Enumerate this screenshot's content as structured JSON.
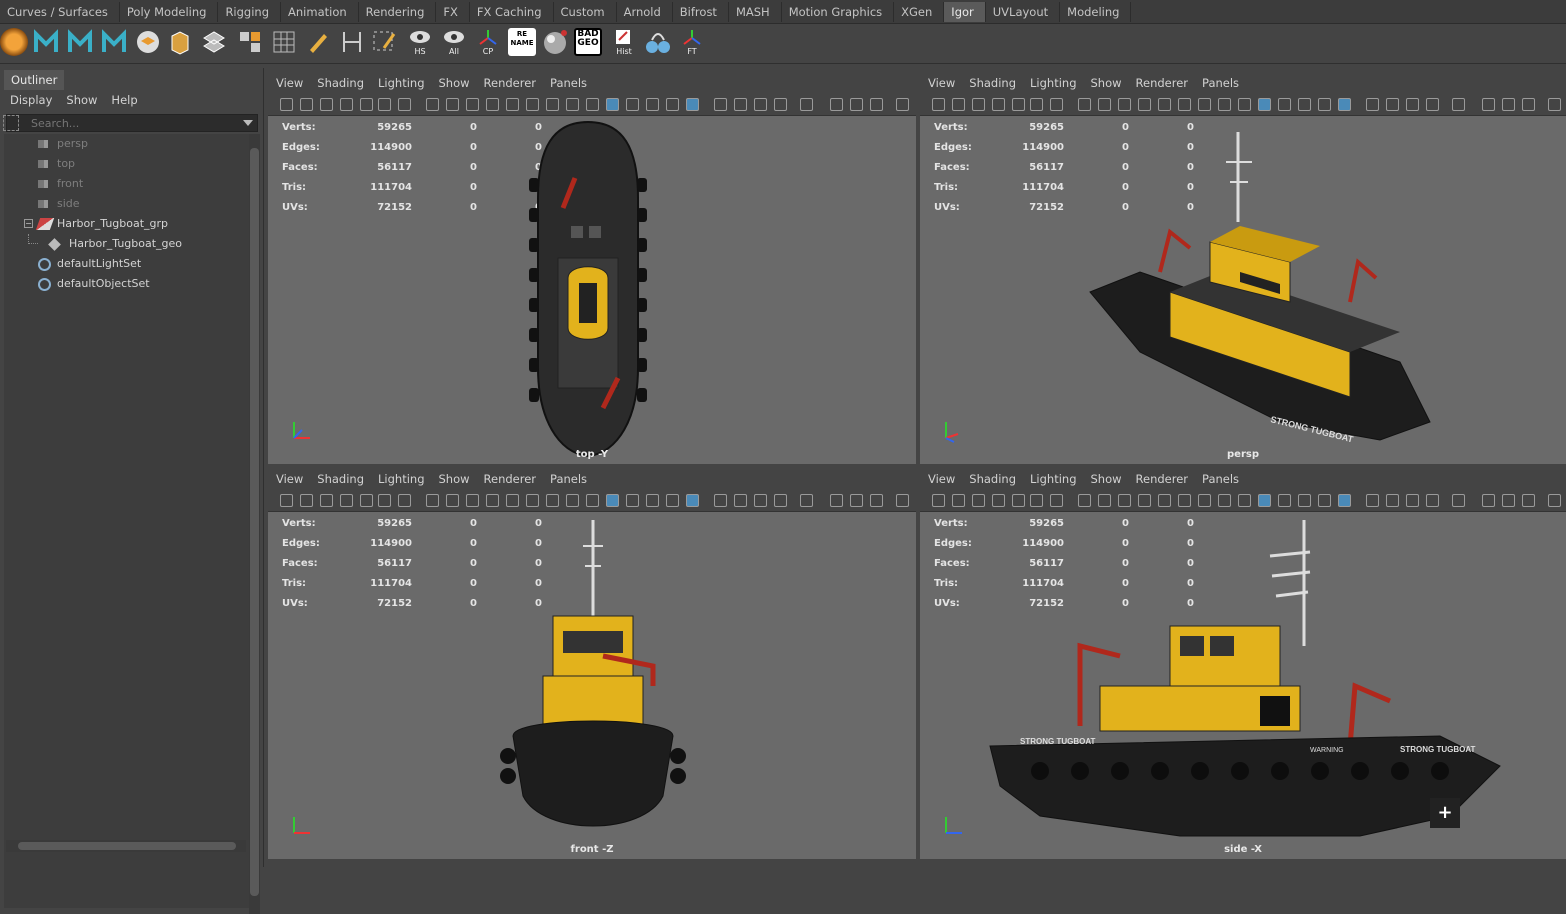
{
  "shelf_tabs": [
    "Curves / Surfaces",
    "Poly Modeling",
    "Rigging",
    "Animation",
    "Rendering",
    "FX",
    "FX Caching",
    "Custom",
    "Arnold",
    "Bifrost",
    "MASH",
    "Motion Graphics",
    "XGen",
    "Igor",
    "UVLayout",
    "Modeling"
  ],
  "active_shelf_tab": "Igor",
  "shelf_icons": {
    "hs": "HS",
    "all": "All",
    "cp": "CP",
    "rename": "RE NAME",
    "badgeo": "BAD GEO",
    "hist": "Hist",
    "ft": "FT"
  },
  "outliner": {
    "tab": "Outliner",
    "menu": [
      "Display",
      "Show",
      "Help"
    ],
    "search_placeholder": "Search...",
    "items": [
      {
        "label": "persp",
        "icon": "camera-icon",
        "dim": true
      },
      {
        "label": "top",
        "icon": "camera-icon",
        "dim": true
      },
      {
        "label": "front",
        "icon": "camera-icon",
        "dim": true
      },
      {
        "label": "side",
        "icon": "camera-icon",
        "dim": true
      },
      {
        "label": "Harbor_Tugboat_grp",
        "icon": "group-icon",
        "dim": false
      },
      {
        "label": "Harbor_Tugboat_geo",
        "icon": "mesh-icon",
        "dim": false
      },
      {
        "label": "defaultLightSet",
        "icon": "set-icon",
        "dim": false
      },
      {
        "label": "defaultObjectSet",
        "icon": "set-icon",
        "dim": false
      }
    ]
  },
  "viewport_menu": [
    "View",
    "Shading",
    "Lighting",
    "Show",
    "Renderer",
    "Panels"
  ],
  "hud": {
    "rows": [
      {
        "label": "Verts:",
        "a": "59265",
        "b": "0",
        "c": "0"
      },
      {
        "label": "Edges:",
        "a": "114900",
        "b": "0",
        "c": "0"
      },
      {
        "label": "Faces:",
        "a": "56117",
        "b": "0",
        "c": "0"
      },
      {
        "label": "Tris:",
        "a": "111704",
        "b": "0",
        "c": "0"
      },
      {
        "label": "UVs:",
        "a": "72152",
        "b": "0",
        "c": "0"
      }
    ]
  },
  "viewports": {
    "top": {
      "camera": "top -Y"
    },
    "persp": {
      "camera": "persp"
    },
    "front": {
      "camera": "front -Z"
    },
    "side": {
      "camera": "side -X"
    }
  },
  "boat_text": {
    "hull_name": "STRONG TUGBOAT",
    "warning": "WARNING"
  },
  "colors": {
    "hull": "#1a1a1a",
    "cabin": "#e2b21c",
    "crane": "#b0281c",
    "mast": "#e0e0e0",
    "viewport_bg": "#6a6a6a"
  }
}
